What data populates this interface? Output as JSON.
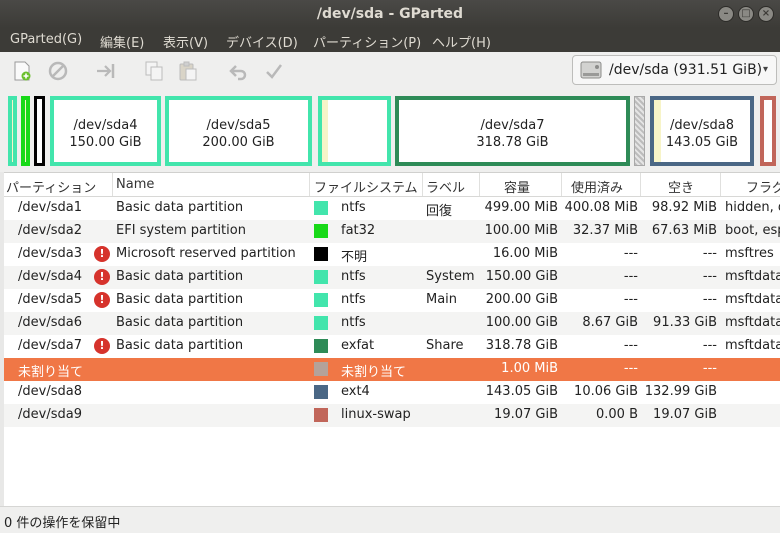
{
  "window": {
    "title": "/dev/sda - GParted"
  },
  "menu": [
    "GParted(G)",
    "編集(E)",
    "表示(V)",
    "デバイス(D)",
    "パーティション(P)",
    "ヘルプ(H)"
  ],
  "toolbar": {
    "new_icon": "new-partition-icon",
    "delete_icon": "delete-icon",
    "resize_icon": "resize-move-icon",
    "copy_icon": "copy-icon",
    "paste_icon": "paste-icon",
    "undo_icon": "undo-icon",
    "apply_icon": "apply-icon"
  },
  "device": {
    "label": "/dev/sda   (931.51 GiB)",
    "icon": "hard-disk-icon"
  },
  "diskmap": [
    {
      "key": "sda1",
      "name": "",
      "size": "",
      "color": "#42e5ac",
      "used": 0.8
    },
    {
      "key": "sda2",
      "name": "",
      "size": "",
      "color": "#18d918",
      "used": 0.3
    },
    {
      "key": "sda3",
      "name": "",
      "size": "",
      "color": "#000000",
      "used": 0
    },
    {
      "key": "sda4",
      "name": "/dev/sda4",
      "size": "150.00 GiB",
      "color": "#42e5ac",
      "used": 0
    },
    {
      "key": "sda5",
      "name": "/dev/sda5",
      "size": "200.00 GiB",
      "color": "#42e5ac",
      "used": 0
    },
    {
      "key": "sda6",
      "name": "",
      "size": "",
      "color": "#42e5ac",
      "used": 0.09
    },
    {
      "key": "sda7",
      "name": "/dev/sda7",
      "size": "318.78 GiB",
      "color": "#2e8b57",
      "used": 0
    },
    {
      "key": "unalloc",
      "name": "",
      "size": "",
      "color": "#a9a9a9",
      "used": 0
    },
    {
      "key": "sda8",
      "name": "/dev/sda8",
      "size": "143.05 GiB",
      "color": "#4a6785",
      "used": 0.07
    },
    {
      "key": "sda9",
      "name": "",
      "size": "",
      "color": "#c1665a",
      "used": 0
    }
  ],
  "columns": [
    "パーティション",
    "Name",
    "ファイルシステム",
    "ラベル",
    "容量",
    "使用済み",
    "空き",
    "フラグ"
  ],
  "rows": [
    {
      "partition": "/dev/sda1",
      "warn": false,
      "name": "Basic data partition",
      "fs": "ntfs",
      "color": "#42e5ac",
      "label": "回復",
      "size": "499.00 MiB",
      "used": "400.08 MiB",
      "free": "98.92 MiB",
      "flags": "hidden, diag"
    },
    {
      "partition": "/dev/sda2",
      "warn": false,
      "name": "EFI system partition",
      "fs": "fat32",
      "color": "#18d918",
      "label": "",
      "size": "100.00 MiB",
      "used": "32.37 MiB",
      "free": "67.63 MiB",
      "flags": "boot, esp"
    },
    {
      "partition": "/dev/sda3",
      "warn": true,
      "name": "Microsoft reserved partition",
      "fs": "不明",
      "color": "#000000",
      "label": "",
      "size": "16.00 MiB",
      "used": "---",
      "free": "---",
      "flags": "msftres"
    },
    {
      "partition": "/dev/sda4",
      "warn": true,
      "name": "Basic data partition",
      "fs": "ntfs",
      "color": "#42e5ac",
      "label": "System",
      "size": "150.00 GiB",
      "used": "---",
      "free": "---",
      "flags": "msftdata"
    },
    {
      "partition": "/dev/sda5",
      "warn": true,
      "name": "Basic data partition",
      "fs": "ntfs",
      "color": "#42e5ac",
      "label": "Main",
      "size": "200.00 GiB",
      "used": "---",
      "free": "---",
      "flags": "msftdata"
    },
    {
      "partition": "/dev/sda6",
      "warn": false,
      "name": "Basic data partition",
      "fs": "ntfs",
      "color": "#42e5ac",
      "label": "",
      "size": "100.00 GiB",
      "used": "8.67 GiB",
      "free": "91.33 GiB",
      "flags": "msftdata"
    },
    {
      "partition": "/dev/sda7",
      "warn": true,
      "name": "Basic data partition",
      "fs": "exfat",
      "color": "#2e8b57",
      "label": "Share",
      "size": "318.78 GiB",
      "used": "---",
      "free": "---",
      "flags": "msftdata"
    },
    {
      "partition": "未割り当て",
      "warn": false,
      "name": "",
      "fs": "未割り当て",
      "color": "#a9a9a9",
      "label": "",
      "size": "1.00 MiB",
      "used": "---",
      "free": "---",
      "flags": "",
      "selected": true
    },
    {
      "partition": "/dev/sda8",
      "warn": false,
      "name": "",
      "fs": "ext4",
      "color": "#4a6785",
      "label": "",
      "size": "143.05 GiB",
      "used": "10.06 GiB",
      "free": "132.99 GiB",
      "flags": ""
    },
    {
      "partition": "/dev/sda9",
      "warn": false,
      "name": "",
      "fs": "linux-swap",
      "color": "#c1665a",
      "label": "",
      "size": "19.07 GiB",
      "used": "0.00 B",
      "free": "19.07 GiB",
      "flags": ""
    }
  ],
  "status": "0 件の操作を保留中"
}
